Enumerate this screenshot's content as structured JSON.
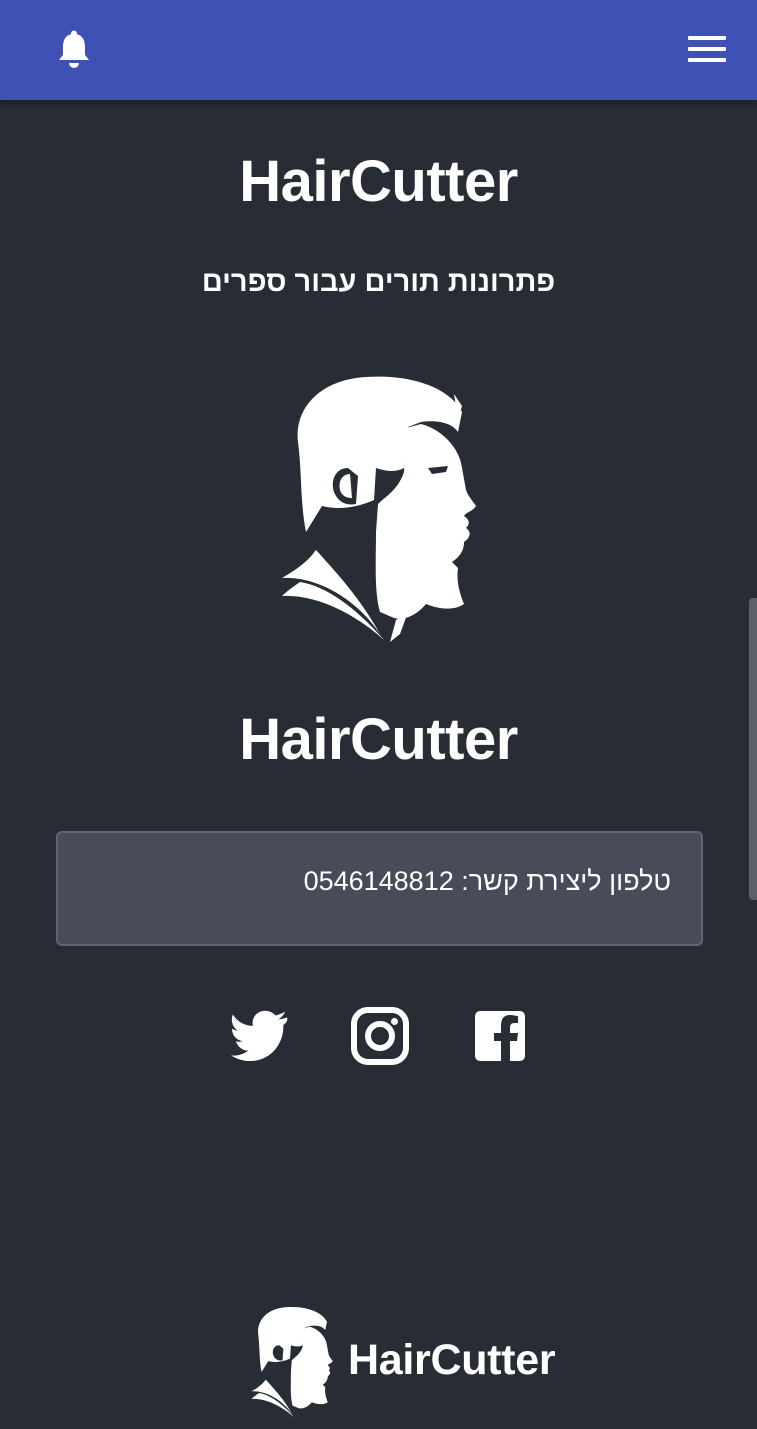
{
  "header": {
    "notification_icon": "bell-icon",
    "menu_icon": "hamburger-menu-icon",
    "background_color": "#3f51b5"
  },
  "hero": {
    "title": "HairCutter",
    "subtitle": "פתרונות תורים עבור ספרים",
    "logo_icon": "bearded-man-profile-logo",
    "brand_name": "HairCutter"
  },
  "contact": {
    "text": "טלפון ליצירת קשר: 0546148812"
  },
  "social": [
    {
      "name": "Twitter",
      "icon": "twitter-icon"
    },
    {
      "name": "Instagram",
      "icon": "instagram-icon"
    },
    {
      "name": "Facebook",
      "icon": "facebook-icon"
    }
  ],
  "footer": {
    "brand_name": "HairCutter",
    "logo_icon": "bearded-man-profile-logo"
  },
  "colors": {
    "page_background": "#282c35",
    "contact_box": "#474c58",
    "text": "#ffffff"
  }
}
